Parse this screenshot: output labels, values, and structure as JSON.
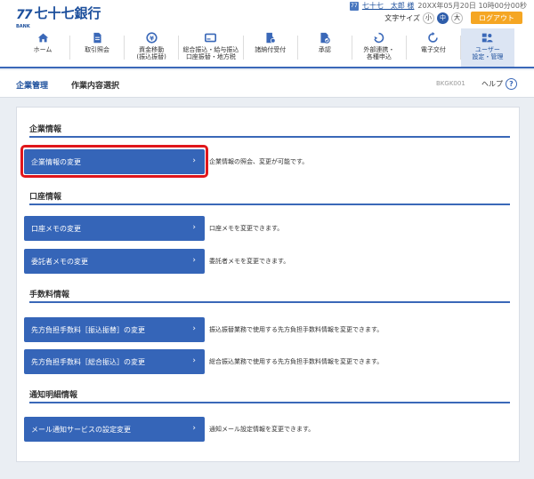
{
  "header": {
    "logo_mark": "77",
    "logo_sub": "BANK",
    "bank_name": "七十七銀行",
    "user_badge": "77",
    "user_name": "七十七　太郎 様",
    "login_time": "20XX年05月20日 10時00分00秒",
    "font_size_label": "文字サイズ",
    "font_sizes": [
      "小",
      "中",
      "大"
    ],
    "logout_label": "ログアウト"
  },
  "nav": {
    "items": [
      {
        "label": "ホーム",
        "icon": "home-icon"
      },
      {
        "label": "取引照会",
        "icon": "document-icon"
      },
      {
        "label": "資金移動\n(振込振替)",
        "icon": "transfer-icon"
      },
      {
        "label": "総合振込・給与振込\n口座振替・地方税",
        "icon": "card-icon"
      },
      {
        "label": "諸納付受付",
        "icon": "pay-icon"
      },
      {
        "label": "承認",
        "icon": "approve-icon"
      },
      {
        "label": "外部連携・\n各種申込",
        "icon": "link-icon"
      },
      {
        "label": "電子交付",
        "icon": "sync-icon"
      },
      {
        "label": "ユーザー\n設定・管理",
        "icon": "user-manage-icon"
      }
    ]
  },
  "titlebar": {
    "breadcrumb": "企業管理",
    "page_title": "作業内容選択",
    "screen_id": "BKGK001",
    "help_label": "ヘルプ",
    "help_icon_text": "?"
  },
  "sections": [
    {
      "title": "企業情報",
      "items": [
        {
          "label": "企業情報の変更",
          "desc": "企業情報の照会、変更が可能です。"
        }
      ]
    },
    {
      "title": "口座情報",
      "items": [
        {
          "label": "口座メモの変更",
          "desc": "口座メモを変更できます。"
        },
        {
          "label": "委託者メモの変更",
          "desc": "委託者メモを変更できます。"
        }
      ]
    },
    {
      "title": "手数料情報",
      "items": [
        {
          "label": "先方負担手数料［振込振替］の変更",
          "desc": "振込振替業務で使用する先方負担手数料情報を変更できます。"
        },
        {
          "label": "先方負担手数料［総合振込］の変更",
          "desc": "総合振込業務で使用する先方負担手数料情報を変更できます。"
        }
      ]
    },
    {
      "title": "通知明細情報",
      "items": [
        {
          "label": "メール通知サービスの設定変更",
          "desc": "通知メール設定情報を変更できます。"
        }
      ]
    }
  ],
  "colors": {
    "brand": "#1c4f9c",
    "button": "#3565b8",
    "highlight": "#e0161b",
    "logout": "#f5a623"
  }
}
